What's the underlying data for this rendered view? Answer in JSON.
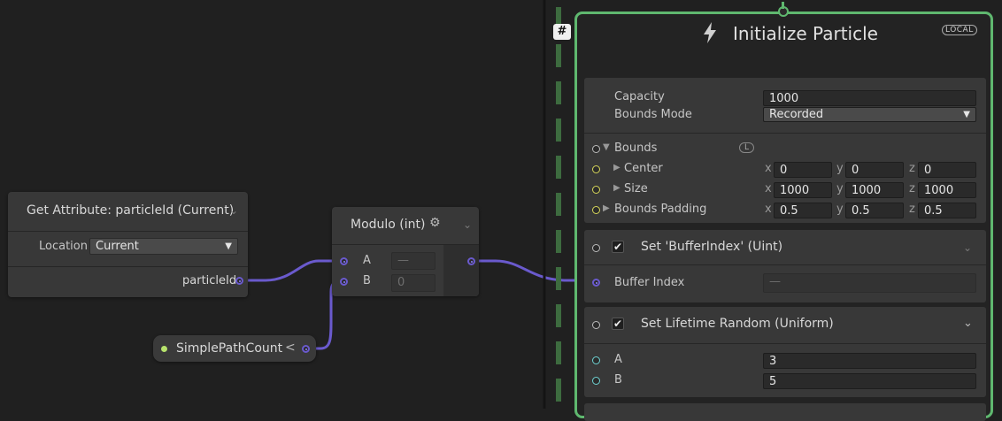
{
  "get_attr": {
    "title": "Get Attribute: particleId (Current)",
    "location_label": "Location",
    "location_value": "Current",
    "output_label": "particleId"
  },
  "modulo": {
    "title": "Modulo (int)",
    "a_label": "A",
    "a_value": "—",
    "b_label": "B",
    "b_value": "0"
  },
  "property": {
    "name": "SimplePathCount",
    "arrow": "<"
  },
  "context": {
    "title": "Initialize Particle",
    "local_badge": "LOCAL",
    "sticky_badge": "#",
    "capacity_label": "Capacity",
    "capacity_value": "1000",
    "bounds_mode_label": "Bounds Mode",
    "bounds_mode_value": "Recorded",
    "bounds_label": "Bounds",
    "bounds_badge": "L",
    "center_label": "Center",
    "center": {
      "x": "0",
      "y": "0",
      "z": "0"
    },
    "size_label": "Size",
    "size": {
      "x": "1000",
      "y": "1000",
      "z": "1000"
    },
    "padding_label": "Bounds Padding",
    "padding": {
      "x": "0.5",
      "y": "0.5",
      "z": "0.5"
    },
    "axis_x": "x",
    "axis_y": "y",
    "axis_z": "z",
    "block1_title": "Set 'BufferIndex'  (Uint)",
    "buffer_index_label": "Buffer Index",
    "buffer_index_value": "—",
    "block2_title": "Set Lifetime Random (Uniform)",
    "lifetime_a_label": "A",
    "lifetime_a_value": "3",
    "lifetime_b_label": "B",
    "lifetime_b_value": "5"
  },
  "colors": {
    "context_border": "#5fb86f",
    "int_port": "#6a5acd",
    "float_port": "#d6d65a",
    "background": "#202020"
  }
}
